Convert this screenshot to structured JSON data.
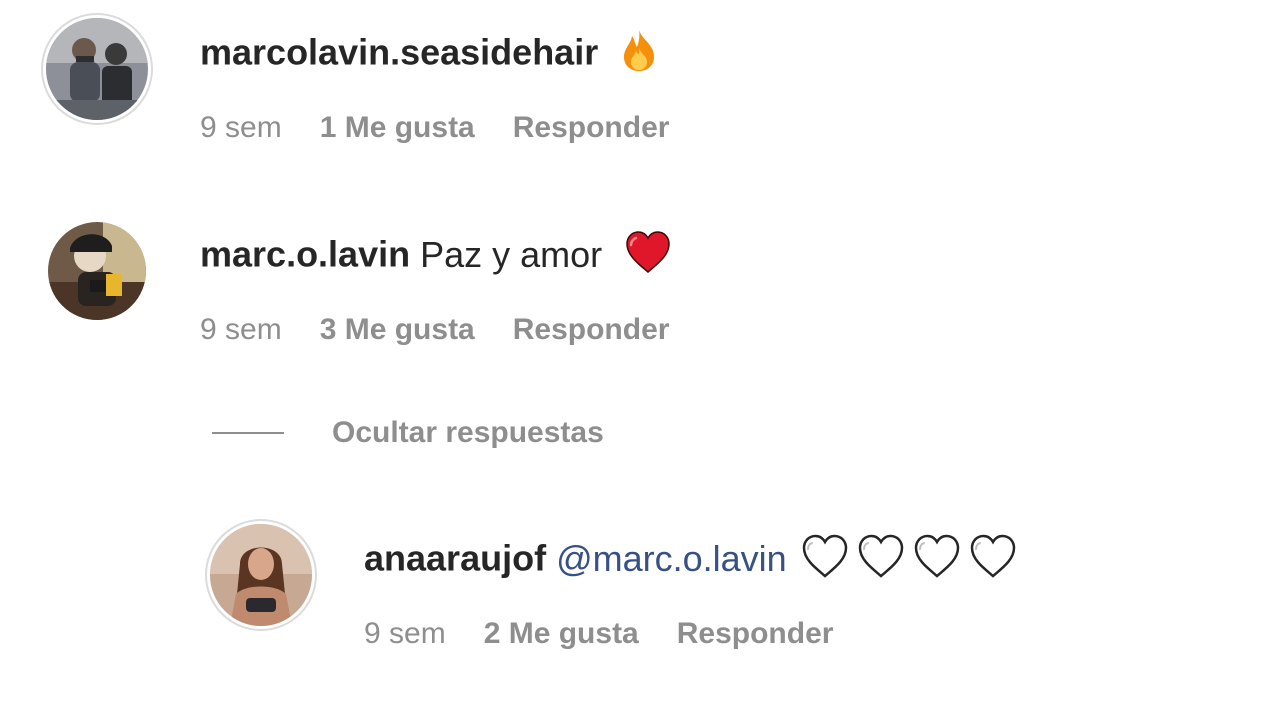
{
  "comments": [
    {
      "username": "marcolavin.seasidehair",
      "text": "",
      "emoji": "fire-icon",
      "time": "9 sem",
      "likes": "1 Me gusta",
      "reply": "Responder"
    },
    {
      "username": "marc.o.lavin",
      "text": "Paz y amor",
      "emoji": "red-heart-icon",
      "time": "9 sem",
      "likes": "3 Me gusta",
      "reply": "Responder"
    }
  ],
  "hide_replies": "Ocultar respuestas",
  "reply_comment": {
    "username": "anaaraujof",
    "mention": "@marc.o.lavin",
    "emoji": "white-heart-icon",
    "time": "9 sem",
    "likes": "2 Me gusta",
    "reply": "Responder"
  },
  "colors": {
    "text": "#262626",
    "secondary": "#8e8e8e",
    "mention": "#385185",
    "heart_red": "#e0172a"
  }
}
